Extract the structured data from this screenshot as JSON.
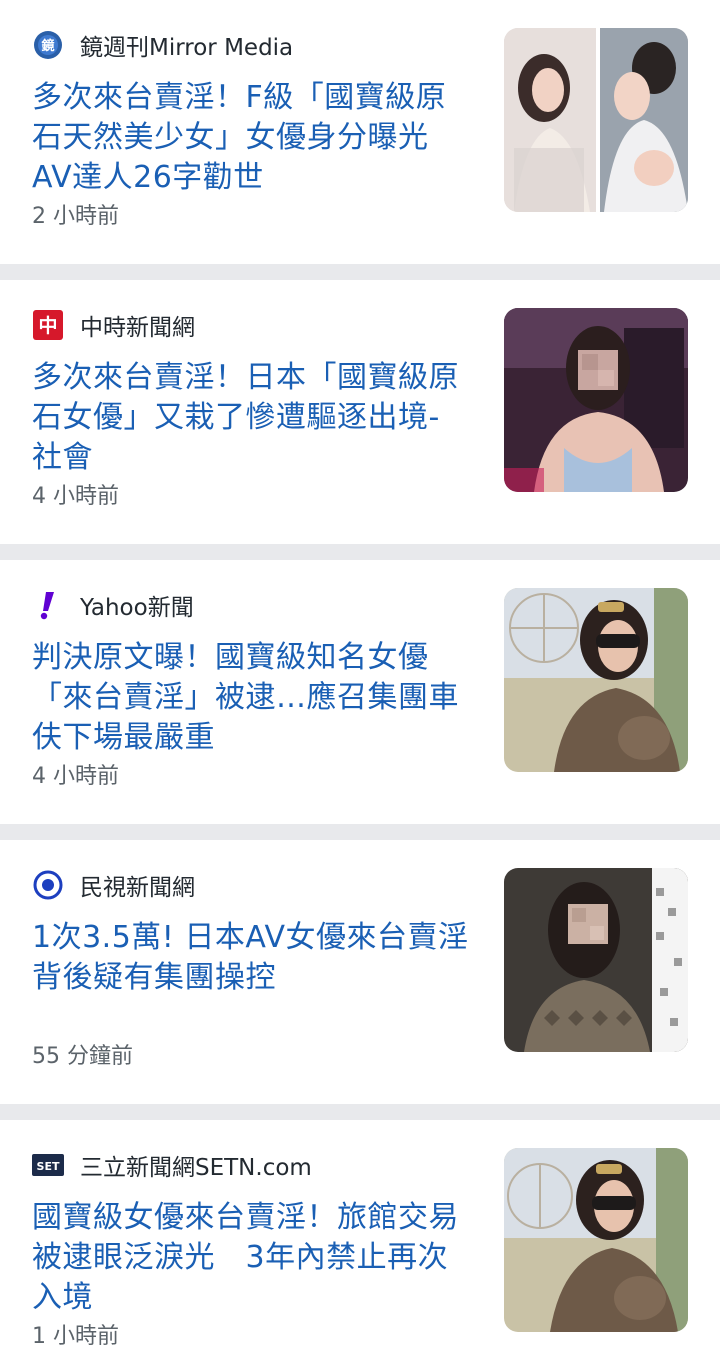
{
  "articles": [
    {
      "source": "鏡週刊Mirror Media",
      "source_icon": "mirror-media-logo",
      "headline": "多次來台賣淫！F級「國寶級原石天然美少女」女優身分曝光 AV達人26字勸世",
      "time": "2 小時前",
      "thumbnail": "photo-collage-two-women"
    },
    {
      "source": "中時新聞網",
      "source_icon": "chinatimes-logo",
      "headline": "多次來台賣淫！日本「國寶級原石女優」又栽了慘遭驅逐出境- 社會",
      "time": "4 小時前",
      "thumbnail": "photo-woman-blurred-face"
    },
    {
      "source": "Yahoo新聞",
      "source_icon": "yahoo-exclamation-logo",
      "headline": "判決原文曝！國寶級知名女優「來台賣淫」被逮…應召集團車伕下場最嚴重",
      "time": "4 小時前",
      "thumbnail": "photo-woman-sunglasses"
    },
    {
      "source": "民視新聞網",
      "source_icon": "ftv-eye-logo",
      "headline": "1次3.5萬! 日本AV女優來台賣淫背後疑有集團操控",
      "time": "55 分鐘前",
      "thumbnail": "photo-woman-blurred-face-2"
    },
    {
      "source": "三立新聞網SETN.com",
      "source_icon": "setn-logo",
      "headline": "國寶級女優來台賣淫！旅館交易被逮眼泛淚光　3年內禁止再次入境",
      "time": "1 小時前",
      "thumbnail": "photo-woman-sunglasses-2"
    }
  ],
  "colors": {
    "headline": "#1a5fb4",
    "source_text": "#232a31",
    "time_text": "#5b636a",
    "divider": "#e8e9ec",
    "yahoo_purple": "#6001d2",
    "chinatimes_red": "#d6182b",
    "setn_navy": "#1c2b4a"
  }
}
